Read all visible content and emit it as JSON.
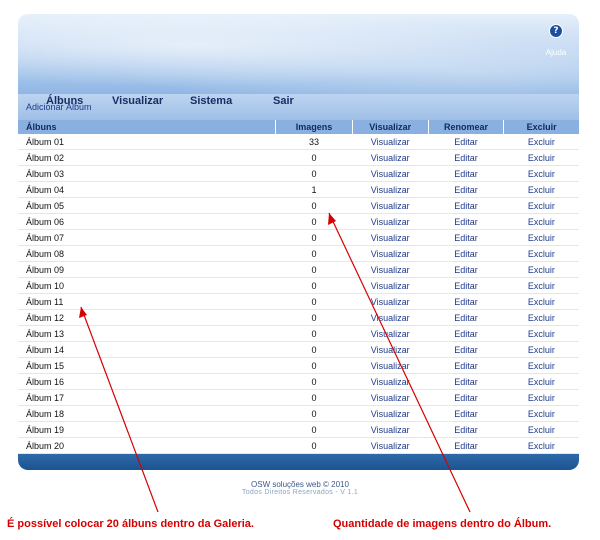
{
  "header": {
    "help_label": "Ajuda",
    "help_icon": "help-icon"
  },
  "nav": [
    "Álbuns",
    "Visualizar",
    "Sistema",
    "Sair"
  ],
  "add_link": "Adicionar Álbum",
  "table": {
    "headers": [
      "Álbuns",
      "Imagens",
      "Visualizar",
      "Renomear",
      "Excluir"
    ],
    "rows": [
      {
        "name": "Álbum 01",
        "count": "33",
        "view": "Visualizar",
        "rename": "Editar",
        "del": "Excluir"
      },
      {
        "name": "Álbum 02",
        "count": "0",
        "view": "Visualizar",
        "rename": "Editar",
        "del": "Excluir"
      },
      {
        "name": "Álbum 03",
        "count": "0",
        "view": "Visualizar",
        "rename": "Editar",
        "del": "Excluir"
      },
      {
        "name": "Álbum 04",
        "count": "1",
        "view": "Visualizar",
        "rename": "Editar",
        "del": "Excluir"
      },
      {
        "name": "Álbum 05",
        "count": "0",
        "view": "Visualizar",
        "rename": "Editar",
        "del": "Excluir"
      },
      {
        "name": "Álbum 06",
        "count": "0",
        "view": "Visualizar",
        "rename": "Editar",
        "del": "Excluir"
      },
      {
        "name": "Álbum 07",
        "count": "0",
        "view": "Visualizar",
        "rename": "Editar",
        "del": "Excluir"
      },
      {
        "name": "Álbum 08",
        "count": "0",
        "view": "Visualizar",
        "rename": "Editar",
        "del": "Excluir"
      },
      {
        "name": "Álbum 09",
        "count": "0",
        "view": "Visualizar",
        "rename": "Editar",
        "del": "Excluir"
      },
      {
        "name": "Álbum 10",
        "count": "0",
        "view": "Visualizar",
        "rename": "Editar",
        "del": "Excluir"
      },
      {
        "name": "Álbum 11",
        "count": "0",
        "view": "Visualizar",
        "rename": "Editar",
        "del": "Excluir"
      },
      {
        "name": "Álbum 12",
        "count": "0",
        "view": "Visualizar",
        "rename": "Editar",
        "del": "Excluir"
      },
      {
        "name": "Álbum 13",
        "count": "0",
        "view": "Visualizar",
        "rename": "Editar",
        "del": "Excluir"
      },
      {
        "name": "Álbum 14",
        "count": "0",
        "view": "Visualizar",
        "rename": "Editar",
        "del": "Excluir"
      },
      {
        "name": "Álbum 15",
        "count": "0",
        "view": "Visualizar",
        "rename": "Editar",
        "del": "Excluir"
      },
      {
        "name": "Álbum 16",
        "count": "0",
        "view": "Visualizar",
        "rename": "Editar",
        "del": "Excluir"
      },
      {
        "name": "Álbum 17",
        "count": "0",
        "view": "Visualizar",
        "rename": "Editar",
        "del": "Excluir"
      },
      {
        "name": "Álbum 18",
        "count": "0",
        "view": "Visualizar",
        "rename": "Editar",
        "del": "Excluir"
      },
      {
        "name": "Álbum 19",
        "count": "0",
        "view": "Visualizar",
        "rename": "Editar",
        "del": "Excluir"
      },
      {
        "name": "Álbum 20",
        "count": "0",
        "view": "Visualizar",
        "rename": "Editar",
        "del": "Excluir"
      }
    ]
  },
  "footer": {
    "line1": "OSW soluções web © 2010",
    "line2": "Todos Direitos Reservados - V 1.1"
  },
  "annotations": {
    "left": "É possível colocar 20 álbuns dentro da Galeria.",
    "right": "Quantidade de imagens dentro do Álbum.",
    "color": "#d60000"
  },
  "colors": {
    "header_top": "#e6f0fb",
    "nav": "#a9c8ec",
    "table_header": "#8ab0e2",
    "footer_bar": "#1c5391",
    "link": "#1f3a8a"
  }
}
